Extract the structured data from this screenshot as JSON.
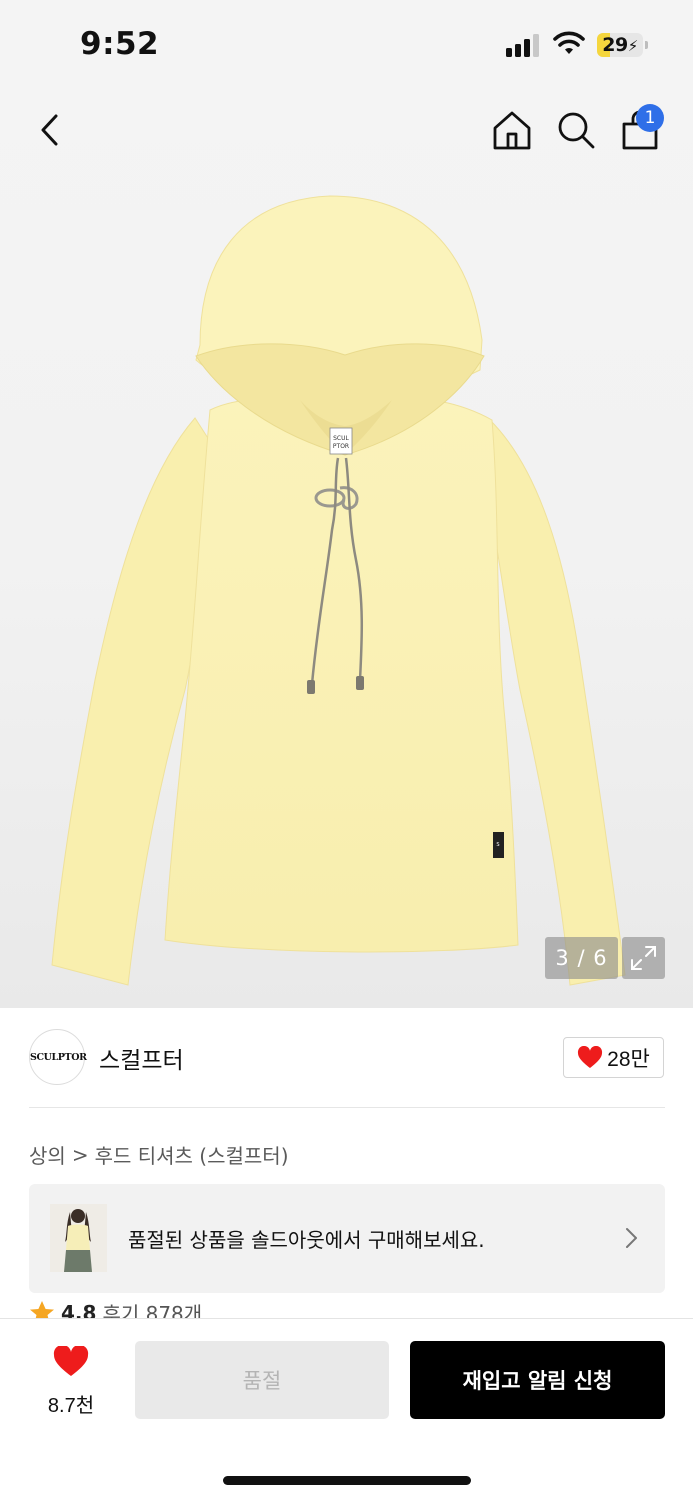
{
  "status_bar": {
    "time": "9:52",
    "battery_level": "29",
    "battery_fraction": 0.29
  },
  "nav": {
    "back_icon": "chevron-left-icon",
    "home_icon": "home-icon",
    "search_icon": "search-icon",
    "cart_icon": "shopping-bag-icon",
    "cart_count": "1"
  },
  "gallery": {
    "counter": "3 / 6",
    "expand_icon": "expand-icon",
    "product_colors": {
      "body": "#fbf2b7",
      "shade": "#efe29a",
      "cord": "#8d8a80"
    }
  },
  "brand": {
    "logo_text": "SCULPTOR",
    "name": "스컬프터",
    "like_count": "28만",
    "like_icon": "heart-icon"
  },
  "breadcrumb": {
    "category": "상의",
    "separator": ">",
    "subcategory": "후드 티셔츠 (스컬프터)"
  },
  "soldout_banner": {
    "text": "품절된 상품을 솔드아웃에서 구매해보세요.",
    "chevron_icon": "chevron-right-icon"
  },
  "rating": {
    "star_icon": "star-icon",
    "score": "4.8",
    "reviews": "후기 878개"
  },
  "bottom_bar": {
    "wish_count": "8.7천",
    "soldout_label": "품절",
    "restock_label": "재입고 알림 신청"
  },
  "colors": {
    "accent_red": "#ee1c1c",
    "badge_blue": "#2f6fe8",
    "primary_button": "#000000",
    "disabled_button": "#e9e9e9",
    "rating_star": "#f5a623"
  }
}
